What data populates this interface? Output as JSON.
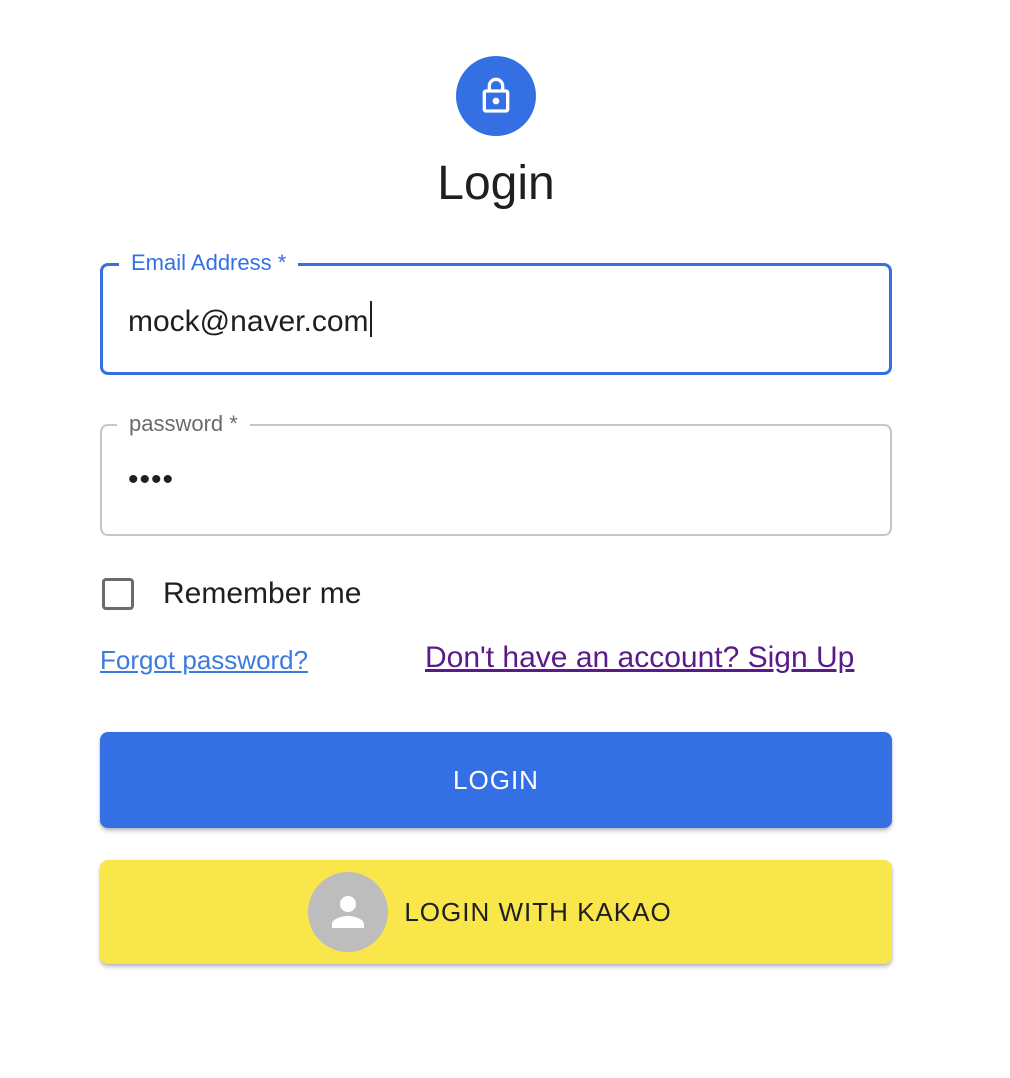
{
  "header": {
    "icon": "lock-icon",
    "title": "Login"
  },
  "form": {
    "email": {
      "label": "Email Address",
      "required_mark": "*",
      "value": "mock@naver.com"
    },
    "password": {
      "label": "password",
      "required_mark": "*",
      "masked_value": "••••"
    },
    "remember_me": {
      "label": "Remember me",
      "checked": false
    }
  },
  "links": {
    "forgot_password": "Forgot password?",
    "sign_up": "Don't have an account? Sign Up"
  },
  "buttons": {
    "login": "LOGIN",
    "kakao": "LOGIN WITH KAKAO",
    "kakao_icon": "person-icon"
  },
  "colors": {
    "primary": "#3470e4",
    "kakao_yellow": "#f9e64b",
    "visited_link": "#5a1a8a"
  }
}
